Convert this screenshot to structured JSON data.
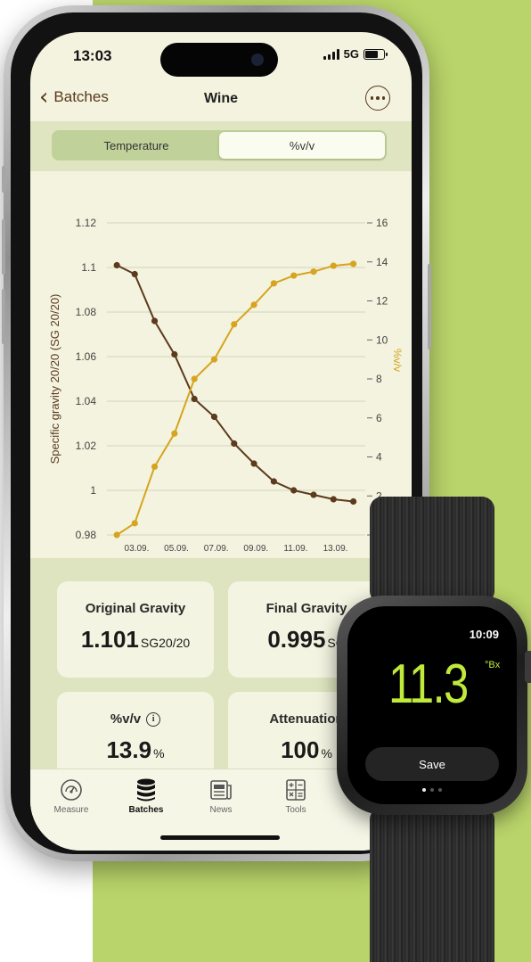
{
  "status_bar": {
    "time": "13:03",
    "network": "5G"
  },
  "nav": {
    "back_label": "Batches",
    "title": "Wine"
  },
  "segments": {
    "items": [
      "Temperature",
      "%v/v"
    ],
    "selected": "%v/v"
  },
  "chart_data": {
    "type": "line",
    "x": [
      "03.09.",
      "05.09.",
      "07.09.",
      "09.09.",
      "11.09.",
      "13.09."
    ],
    "ylabel": "Specific gravity 20/20 (SG 20/20)",
    "y2label": "%v/v",
    "ylim": [
      0.98,
      1.12
    ],
    "y2lim": [
      0,
      16
    ],
    "yticks": [
      "0.98",
      "1",
      "1.02",
      "1.04",
      "1.06",
      "1.08",
      "1.1",
      "1.12"
    ],
    "y2ticks": [
      "0",
      "2",
      "4",
      "6",
      "8",
      "10",
      "12",
      "14",
      "16"
    ],
    "grid": true,
    "series": [
      {
        "color": "#5c3a1e",
        "axis": "left",
        "points": [
          [
            2.0,
            1.101
          ],
          [
            2.9,
            1.097
          ],
          [
            3.9,
            1.076
          ],
          [
            4.9,
            1.061
          ],
          [
            5.9,
            1.041
          ],
          [
            6.9,
            1.033
          ],
          [
            7.9,
            1.021
          ],
          [
            8.9,
            1.012
          ],
          [
            9.9,
            1.004
          ],
          [
            10.9,
            1.0
          ],
          [
            11.9,
            0.998
          ],
          [
            12.9,
            0.996
          ],
          [
            13.9,
            0.995
          ]
        ]
      },
      {
        "color": "#d6a41e",
        "axis": "right",
        "points": [
          [
            2.0,
            0.0
          ],
          [
            2.9,
            0.6
          ],
          [
            3.9,
            3.5
          ],
          [
            4.9,
            5.2
          ],
          [
            5.9,
            8.0
          ],
          [
            6.9,
            9.0
          ],
          [
            7.9,
            10.8
          ],
          [
            8.9,
            11.8
          ],
          [
            9.9,
            12.9
          ],
          [
            10.9,
            13.3
          ],
          [
            11.9,
            13.5
          ],
          [
            12.9,
            13.8
          ],
          [
            13.9,
            13.9
          ]
        ]
      }
    ]
  },
  "stats": {
    "og_label": "Original Gravity",
    "og_value": "1.101",
    "og_unit": "SG20/20",
    "fg_label": "Final Gravity",
    "fg_value": "0.995",
    "fg_unit": "SG",
    "abv_label": "%v/v",
    "abv_value": "13.9",
    "abv_unit": "%",
    "att_label": "Attenuation",
    "att_value": "100",
    "att_unit": "%"
  },
  "tabbar": {
    "items": [
      {
        "label": "Measure",
        "icon": "gauge-icon"
      },
      {
        "label": "Batches",
        "icon": "database-icon"
      },
      {
        "label": "News",
        "icon": "newspaper-icon"
      },
      {
        "label": "Tools",
        "icon": "calculator-icon"
      }
    ],
    "selected": "Batches"
  },
  "watch": {
    "time": "10:09",
    "reading": "11.3",
    "unit": "°Bx",
    "save_label": "Save"
  },
  "colors": {
    "background_green": "#b9d46a",
    "sg_line": "#5c3a1e",
    "abv_line": "#d6a41e",
    "watch_reading": "#c0ea3a"
  }
}
